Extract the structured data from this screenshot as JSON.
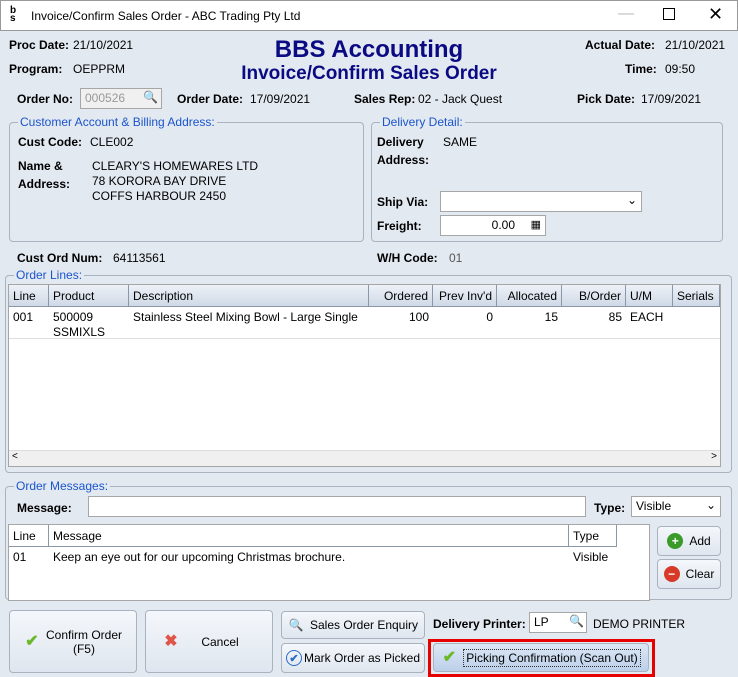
{
  "window": {
    "title": "Invoice/Confirm Sales Order - ABC Trading Pty Ltd",
    "logo": "bbs"
  },
  "header": {
    "app": "BBS Accounting",
    "subtitle": "Invoice/Confirm Sales Order",
    "proc_date_label": "Proc Date:",
    "proc_date": "21/10/2021",
    "program_label": "Program:",
    "program": "OEPPRM",
    "actual_date_label": "Actual Date:",
    "actual_date": "21/10/2021",
    "time_label": "Time:",
    "time": "09:50",
    "order_no_label": "Order No:",
    "order_no": "000526",
    "order_date_label": "Order Date:",
    "order_date": "17/09/2021",
    "sales_rep_label": "Sales Rep:",
    "sales_rep": "02 - Jack Quest",
    "pick_date_label": "Pick Date:",
    "pick_date": "17/09/2021"
  },
  "customer": {
    "legend": "Customer Account & Billing Address:",
    "code_label": "Cust Code:",
    "code": "CLE002",
    "name_label": "Name &",
    "address_label": "Address:",
    "lines": [
      "CLEARY'S HOMEWARES LTD",
      "78 KORORA BAY DRIVE",
      "COFFS HARBOUR 2450"
    ],
    "ord_num_label": "Cust Ord Num:",
    "ord_num": "64113561"
  },
  "delivery": {
    "legend": "Delivery Detail:",
    "delivery_label": "Delivery",
    "address_label": "Address:",
    "address": "SAME",
    "ship_via_label": "Ship Via:",
    "ship_via": "",
    "freight_label": "Freight:",
    "freight": "0.00",
    "wh_label": "W/H Code:",
    "wh": "01"
  },
  "order_lines": {
    "legend": "Order Lines:",
    "columns": [
      "Line",
      "Product",
      "Description",
      "Ordered",
      "Prev Inv'd",
      "Allocated",
      "B/Order",
      "U/M",
      "Serials"
    ],
    "rows": [
      {
        "line": "001",
        "product": "500009",
        "product2": "SSMIXLS",
        "description": "Stainless Steel Mixing Bowl - Large Single",
        "ordered": "100",
        "prev": "0",
        "allocated": "15",
        "border": "85",
        "um": "EACH",
        "serials": ""
      }
    ]
  },
  "messages": {
    "legend": "Order Messages:",
    "message_label": "Message:",
    "message": "",
    "type_label": "Type:",
    "type": "Visible",
    "columns": [
      "Line",
      "Message",
      "Type"
    ],
    "rows": [
      {
        "line": "01",
        "message": "Keep an eye out for our upcoming Christmas brochure.",
        "type": "Visible"
      }
    ],
    "add": "Add",
    "clear": "Clear"
  },
  "footer": {
    "confirm": "Confirm Order",
    "confirm2": "(F5)",
    "cancel": "Cancel",
    "enquiry": "Sales Order Enquiry",
    "mark_picked": "Mark Order as Picked",
    "printer_label": "Delivery Printer:",
    "printer": "LP",
    "printer_name": "DEMO PRINTER",
    "picking": "Picking Confirmation (Scan Out)"
  },
  "colors": {
    "title": "#0a0a82",
    "legend": "#1a55c9",
    "highlight": "#e60000"
  }
}
